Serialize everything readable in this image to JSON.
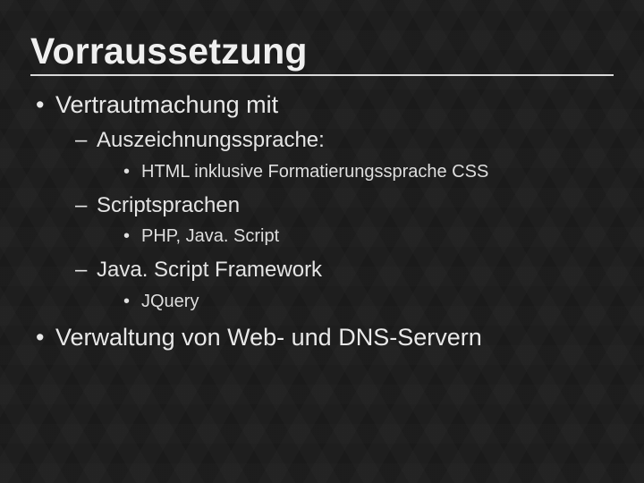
{
  "title": "Vorraussetzung",
  "bullets": {
    "items": [
      {
        "text": "Vertrautmachung mit",
        "children": [
          {
            "text": "Auszeichnungssprache:",
            "children": [
              {
                "text": "HTML inklusive Formatierungssprache CSS"
              }
            ]
          },
          {
            "text": "Scriptsprachen",
            "children": [
              {
                "text": "PHP, Java. Script"
              }
            ]
          },
          {
            "text": "Java. Script Framework",
            "children": [
              {
                "text": "JQuery"
              }
            ]
          }
        ]
      },
      {
        "text": "Verwaltung von Web- und DNS-Servern"
      }
    ]
  }
}
